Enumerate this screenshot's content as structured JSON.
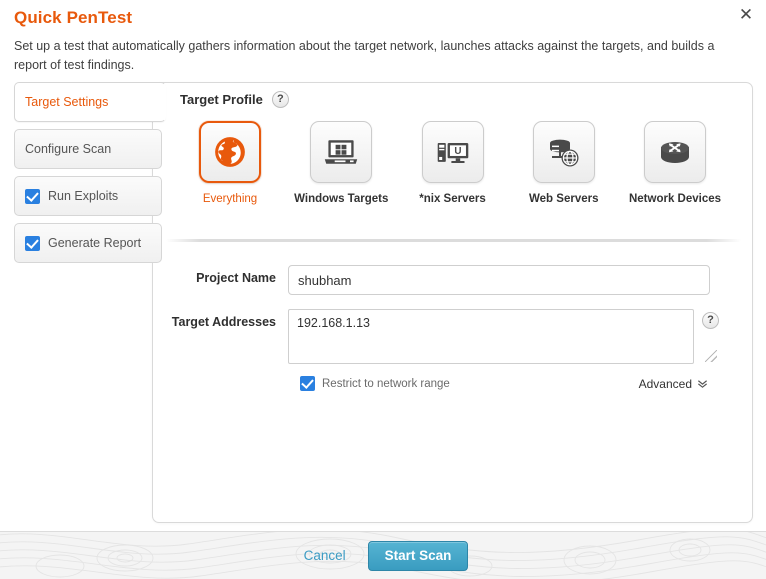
{
  "dialog": {
    "title": "Quick PenTest",
    "description": "Set up a test that automatically gathers information about the target network, launches attacks against the targets, and builds a report of test findings.",
    "close_label": "✕"
  },
  "tabs": [
    {
      "label": "Target Settings",
      "active": true,
      "checkbox": false
    },
    {
      "label": "Configure Scan",
      "active": false,
      "checkbox": false
    },
    {
      "label": "Run Exploits",
      "active": false,
      "checkbox": true,
      "checked": true
    },
    {
      "label": "Generate Report",
      "active": false,
      "checkbox": true,
      "checked": true
    }
  ],
  "target_profile": {
    "heading": "Target Profile",
    "help_label": "?",
    "options": [
      {
        "label": "Everything",
        "icon": "globe-icon",
        "selected": true
      },
      {
        "label": "Windows Targets",
        "icon": "laptop-windows-icon",
        "selected": false
      },
      {
        "label": "*nix Servers",
        "icon": "unix-desktop-icon",
        "selected": false
      },
      {
        "label": "Web Servers",
        "icon": "server-globe-icon",
        "selected": false
      },
      {
        "label": "Network Devices",
        "icon": "router-icon",
        "selected": false
      }
    ]
  },
  "form": {
    "project_name": {
      "label": "Project Name",
      "value": "shubham",
      "placeholder": ""
    },
    "target_addresses": {
      "label": "Target Addresses",
      "value": "192.168.1.13",
      "placeholder": "",
      "help_label": "?"
    },
    "restrict_checkbox": {
      "label": "Restrict to network range",
      "checked": true
    },
    "advanced": {
      "label": "Advanced",
      "chevron": "»"
    }
  },
  "footer": {
    "cancel_label": "Cancel",
    "start_label": "Start Scan"
  },
  "colors": {
    "accent_orange": "#e8590c",
    "link_blue": "#3c9cc4",
    "checkbox_blue": "#2a80e0",
    "button_blue": "#3a9cc0"
  }
}
